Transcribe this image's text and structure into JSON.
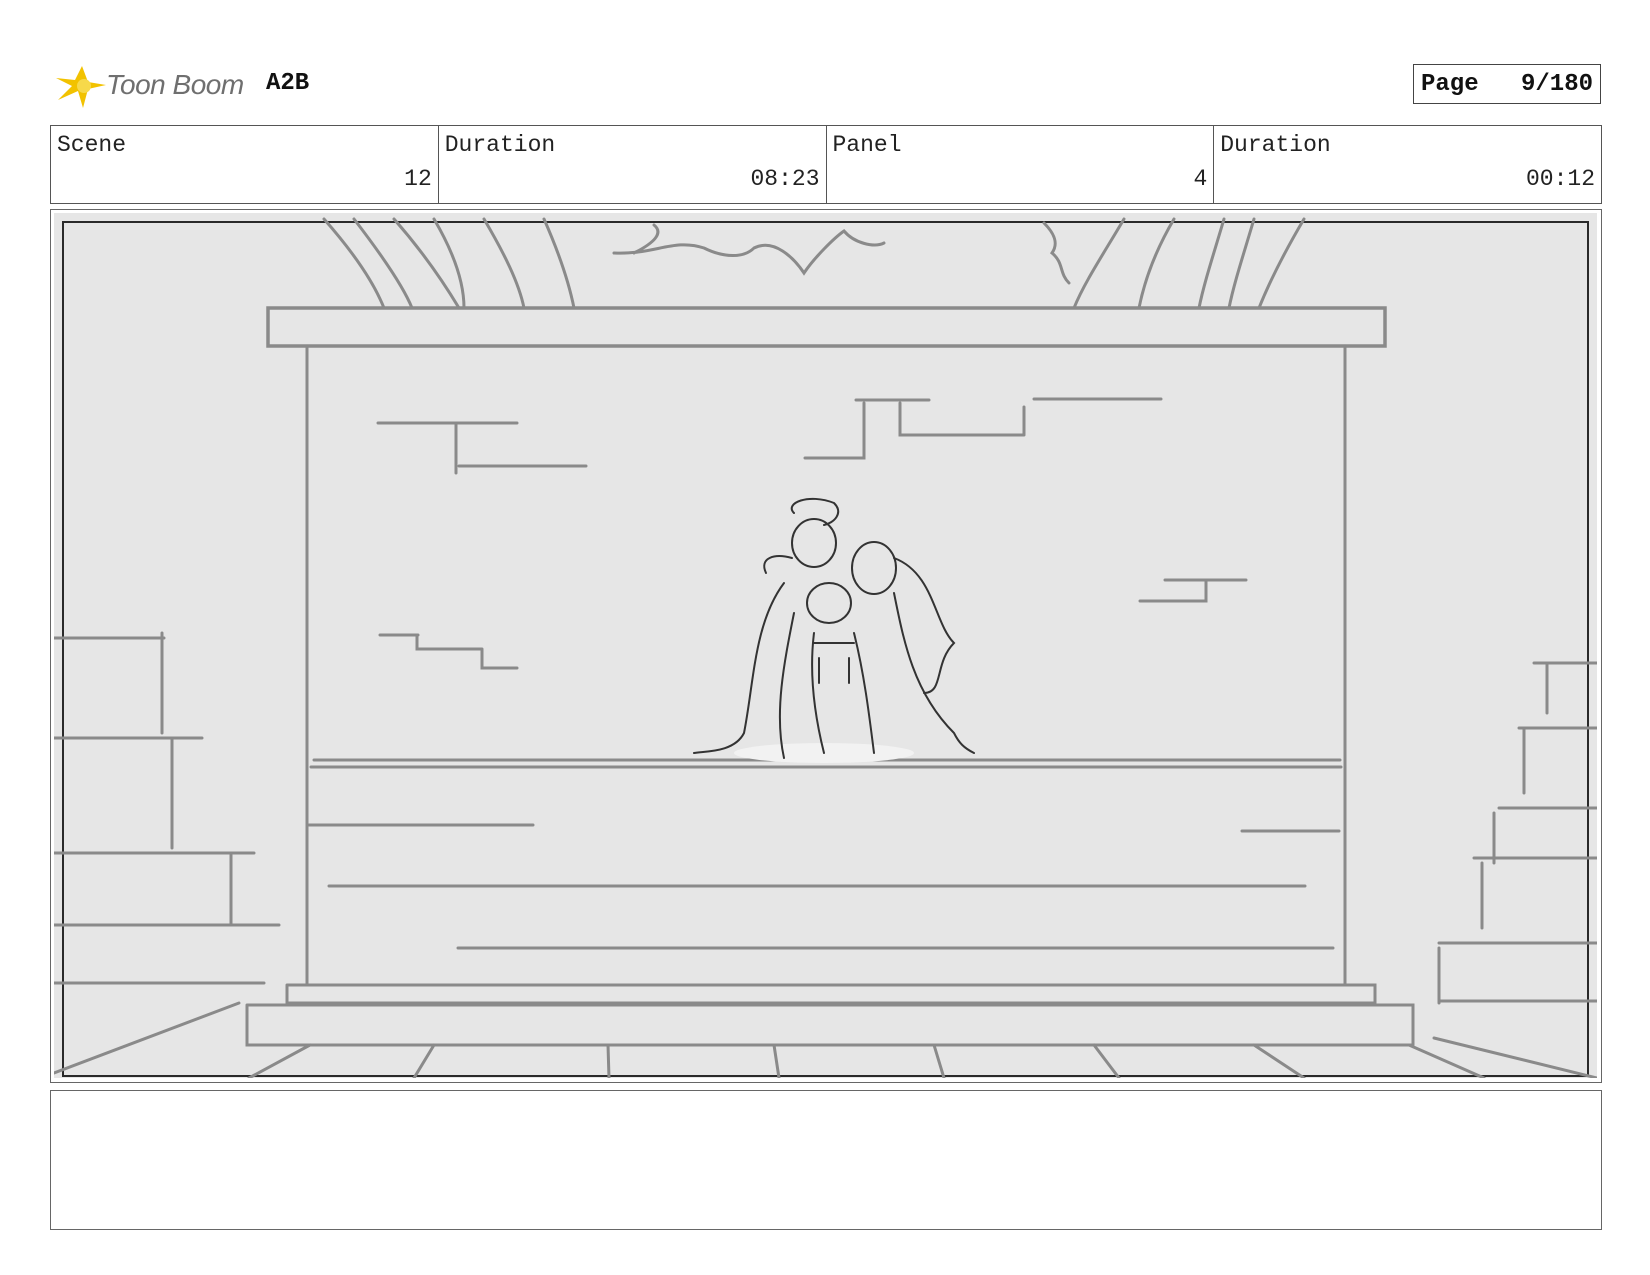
{
  "header": {
    "logo_text": "Toon Boom",
    "project_code": "A2B",
    "page_label": "Page",
    "page_value": "9/180"
  },
  "info": [
    {
      "label": "Scene",
      "value": "12"
    },
    {
      "label": "Duration",
      "value": "08:23"
    },
    {
      "label": "Panel",
      "value": "4"
    },
    {
      "label": "Duration",
      "value": "00:12"
    }
  ],
  "panel": {
    "icon": "storyboard-sketch-stage-three-figures-embracing"
  },
  "notes": {
    "text": ""
  },
  "colors": {
    "panel_background": "#e6e6e6",
    "sketch_line": "#8a8a8a",
    "logo_yellow": "#f2c200"
  }
}
